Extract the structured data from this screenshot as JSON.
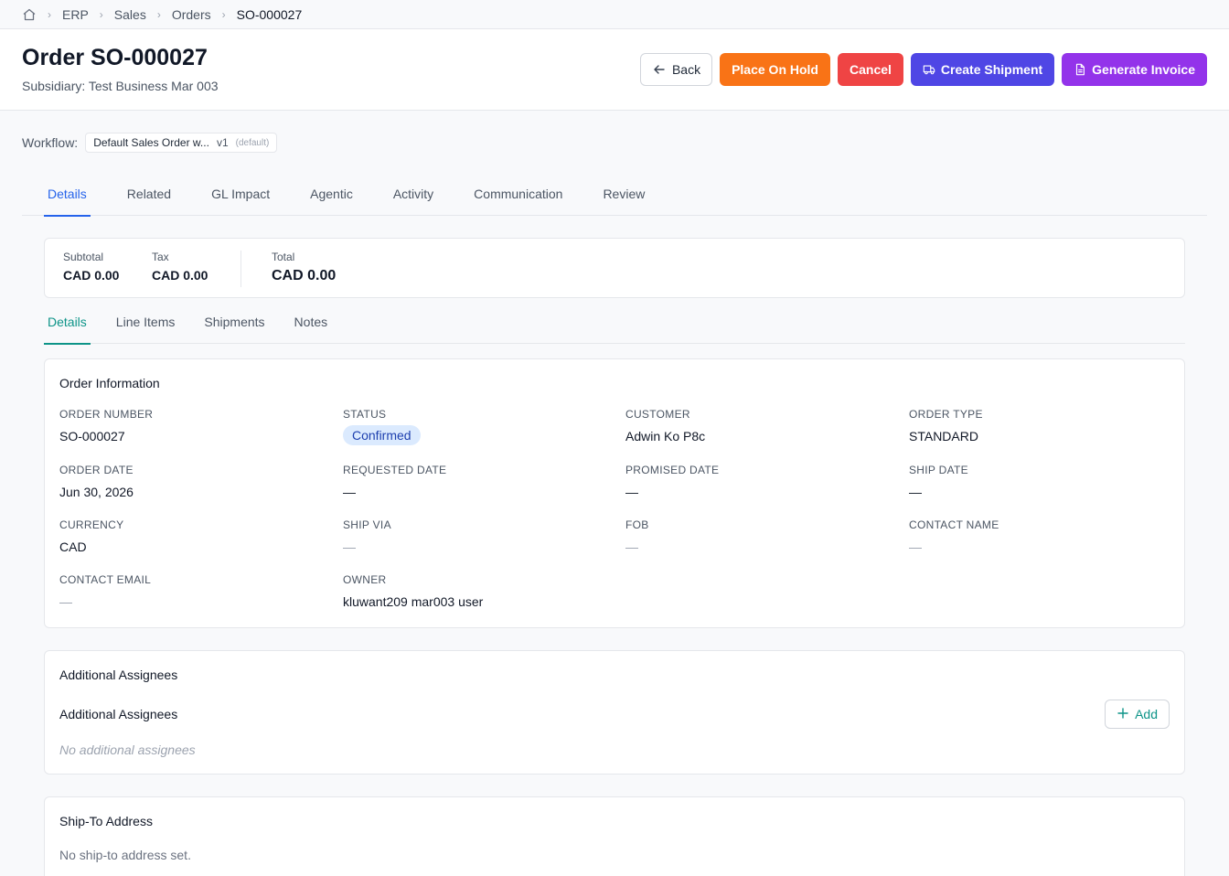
{
  "breadcrumb": {
    "home_icon": "home-icon",
    "items": [
      "ERP",
      "Sales",
      "Orders",
      "SO-000027"
    ]
  },
  "header": {
    "title": "Order SO-000027",
    "subtitle": "Subsidiary: Test Business Mar 003",
    "actions": {
      "back": "Back",
      "hold": "Place On Hold",
      "cancel": "Cancel",
      "shipment": "Create Shipment",
      "invoice": "Generate Invoice"
    },
    "colors": {
      "hold": "#f97316",
      "cancel": "#ef4444",
      "shipment": "#4f46e5",
      "invoice": "#9333ea"
    }
  },
  "workflow": {
    "label": "Workflow:",
    "name": "Default Sales Order w...",
    "version": "v1",
    "tag": "(default)"
  },
  "main_tabs": [
    "Details",
    "Related",
    "GL Impact",
    "Agentic",
    "Activity",
    "Communication",
    "Review"
  ],
  "main_tab_active": "Details",
  "totals": {
    "subtotal_label": "Subtotal",
    "subtotal_value": "CAD 0.00",
    "tax_label": "Tax",
    "tax_value": "CAD 0.00",
    "total_label": "Total",
    "total_value": "CAD 0.00"
  },
  "sub_tabs": [
    "Details",
    "Line Items",
    "Shipments",
    "Notes"
  ],
  "sub_tab_active": "Details",
  "order_info": {
    "title": "Order Information",
    "fields": [
      {
        "label": "ORDER NUMBER",
        "value": "SO-000027"
      },
      {
        "label": "STATUS",
        "value": "Confirmed"
      },
      {
        "label": "CUSTOMER",
        "value": "Adwin Ko P8c"
      },
      {
        "label": "ORDER TYPE",
        "value": "STANDARD"
      },
      {
        "label": "ORDER DATE",
        "value": "Jun 30, 2026"
      },
      {
        "label": "REQUESTED DATE",
        "value": "—"
      },
      {
        "label": "PROMISED DATE",
        "value": "—"
      },
      {
        "label": "SHIP DATE",
        "value": "—"
      },
      {
        "label": "CURRENCY",
        "value": "CAD"
      },
      {
        "label": "SHIP VIA",
        "value": "—"
      },
      {
        "label": "FOB",
        "value": "—"
      },
      {
        "label": "CONTACT NAME",
        "value": "—"
      },
      {
        "label": "CONTACT EMAIL",
        "value": "—"
      },
      {
        "label": "OWNER",
        "value": "kluwant209 mar003 user"
      }
    ]
  },
  "assignees": {
    "title": "Additional Assignees",
    "subtitle": "Additional Assignees",
    "empty": "No additional assignees",
    "add_label": "Add"
  },
  "ship_to": {
    "title": "Ship-To Address",
    "empty": "No ship-to address set."
  }
}
